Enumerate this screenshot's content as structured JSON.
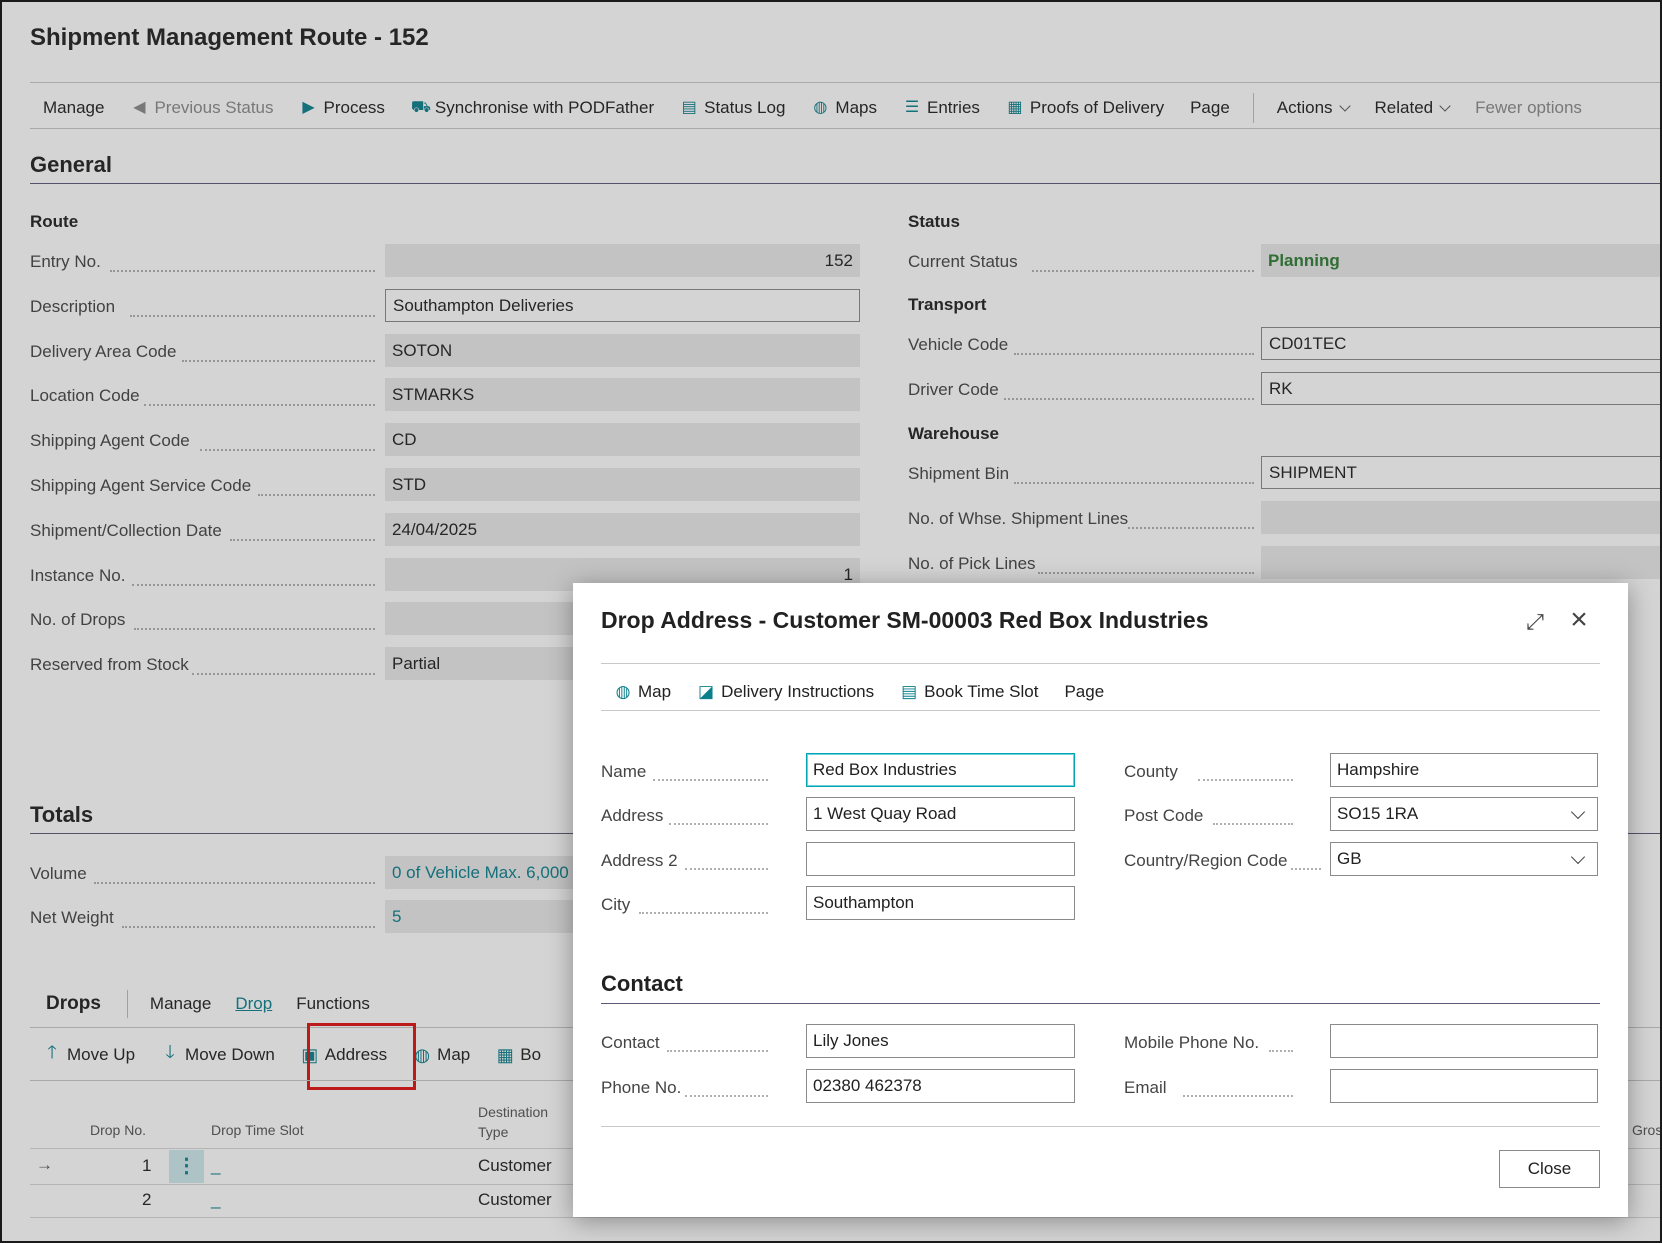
{
  "page": {
    "title": "Shipment Management Route - 152",
    "actions": [
      {
        "label": "Manage",
        "icon": "",
        "disabled": false
      },
      {
        "label": "Previous Status",
        "icon": "arrow-left-icon",
        "disabled": true
      },
      {
        "label": "Process",
        "icon": "play-icon",
        "disabled": false
      },
      {
        "label": "Synchronise with PODFather",
        "icon": "sync-truck-icon",
        "disabled": false
      },
      {
        "label": "Status Log",
        "icon": "log-icon",
        "disabled": false
      },
      {
        "label": "Maps",
        "icon": "globe-icon",
        "disabled": false
      },
      {
        "label": "Entries",
        "icon": "entries-icon",
        "disabled": false
      },
      {
        "label": "Proofs of Delivery",
        "icon": "document-icon",
        "disabled": false
      },
      {
        "label": "Page",
        "icon": "",
        "disabled": false
      }
    ],
    "more_actions": [
      {
        "label": "Actions"
      },
      {
        "label": "Related"
      }
    ],
    "fewer_options": "Fewer options"
  },
  "general": {
    "heading": "General",
    "route": {
      "heading": "Route",
      "fields": [
        {
          "label": "Entry No.",
          "value": "152"
        },
        {
          "label": "Description",
          "value": "Southampton Deliveries"
        },
        {
          "label": "Delivery Area Code",
          "value": "SOTON"
        },
        {
          "label": "Location Code",
          "value": "STMARKS"
        },
        {
          "label": "Shipping Agent Code",
          "value": "CD"
        },
        {
          "label": "Shipping Agent Service Code",
          "value": "STD"
        },
        {
          "label": "Shipment/Collection Date",
          "value": "24/04/2025"
        },
        {
          "label": "Instance No.",
          "value": "1"
        },
        {
          "label": "No. of Drops",
          "value": ""
        },
        {
          "label": "Reserved from Stock",
          "value": "Partial"
        }
      ]
    },
    "status": {
      "heading": "Status",
      "current_status_label": "Current Status",
      "current_status_value": "Planning"
    },
    "transport": {
      "heading": "Transport",
      "vehicle_code_label": "Vehicle Code",
      "vehicle_code_value": "CD01TEC",
      "driver_code_label": "Driver Code",
      "driver_code_value": "RK"
    },
    "warehouse": {
      "heading": "Warehouse",
      "shipment_bin_label": "Shipment Bin",
      "shipment_bin_value": "SHIPMENT",
      "whse_lines_label": "No. of Whse. Shipment Lines",
      "pick_lines_label": "No. of Pick Lines"
    }
  },
  "totals": {
    "heading": "Totals",
    "volume_label": "Volume",
    "volume_value": "0 of Vehicle Max. 6,000 (",
    "net_weight_label": "Net Weight",
    "net_weight_value": "5"
  },
  "drops": {
    "title": "Drops",
    "tabs": [
      {
        "label": "Manage",
        "active": false
      },
      {
        "label": "Drop",
        "active": true
      },
      {
        "label": "Functions",
        "active": false
      }
    ],
    "actions": [
      {
        "label": "Move Up",
        "icon": "arrow-up-icon"
      },
      {
        "label": "Move Down",
        "icon": "arrow-down-icon"
      },
      {
        "label": "Address",
        "icon": "address-icon"
      },
      {
        "label": "Map",
        "icon": "globe-icon"
      },
      {
        "label": "Bo",
        "icon": "book-icon"
      }
    ],
    "columns": {
      "drop_no": "Drop No.",
      "drop_time_slot": "Drop Time Slot",
      "destination_type_1": "Destination",
      "destination_type_2": "Type",
      "gross": "Gros"
    },
    "rows": [
      {
        "drop_no": "1",
        "time_slot": "_",
        "destination_type": "Customer"
      },
      {
        "drop_no": "2",
        "time_slot": "_",
        "destination_type": "Customer"
      }
    ]
  },
  "dialog": {
    "title": "Drop Address - Customer SM-00003 Red Box Industries",
    "actions": [
      {
        "label": "Map",
        "icon": "globe-icon"
      },
      {
        "label": "Delivery Instructions",
        "icon": "note-icon"
      },
      {
        "label": "Book Time Slot",
        "icon": "calendar-icon"
      },
      {
        "label": "Page",
        "icon": ""
      }
    ],
    "name_label": "Name",
    "name_value": "Red Box Industries",
    "address_label": "Address",
    "address_value": "1 West Quay Road",
    "address2_label": "Address 2",
    "address2_value": "",
    "city_label": "City",
    "city_value": "Southampton",
    "county_label": "County",
    "county_value": "Hampshire",
    "post_code_label": "Post Code",
    "post_code_value": "SO15 1RA",
    "country_label": "Country/Region Code",
    "country_value": "GB",
    "contact_heading": "Contact",
    "contact_label": "Contact",
    "contact_value": "Lily Jones",
    "phone_label": "Phone No.",
    "phone_value": "02380 462378",
    "mobile_label": "Mobile Phone No.",
    "mobile_value": "",
    "email_label": "Email",
    "email_value": "",
    "close_label": "Close"
  },
  "colors": {
    "accent": "#0a7f8c",
    "status_green": "#2e7d32",
    "highlight_red": "#e01010"
  }
}
